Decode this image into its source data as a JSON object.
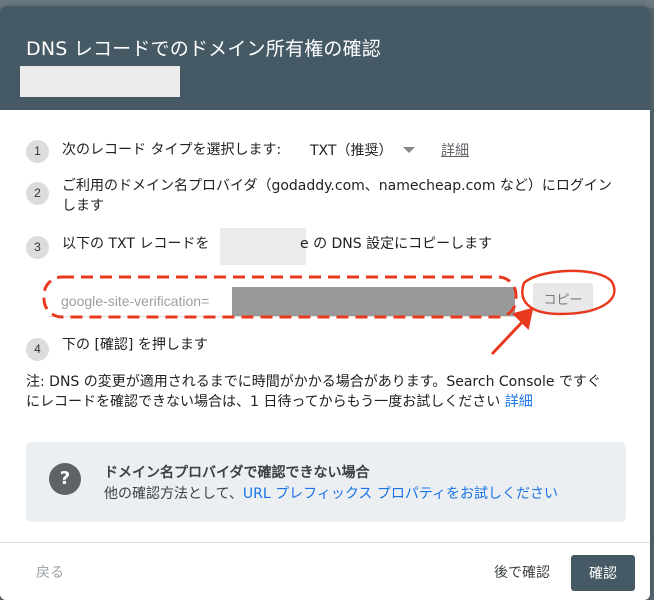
{
  "dialog": {
    "title": "DNS レコードでのドメイン所有権の確認"
  },
  "steps": {
    "s1": {
      "num": "1",
      "text": "次のレコード タイプを選択します:",
      "record_type": "TXT（推奨）",
      "detail_link": "詳細"
    },
    "s2": {
      "num": "2",
      "line1": "ご利用のドメイン名プロバイダ（godaddy.com、namecheap.com など）にログイン",
      "line2": "します"
    },
    "s3": {
      "num": "3",
      "before": "以下の TXT レコードを",
      "after": "e の DNS 設定にコピーします"
    },
    "s4": {
      "num": "4",
      "text": "下の [確認] を押します"
    }
  },
  "record": {
    "prefix": "google-site-verification=",
    "copy_label": "コピー"
  },
  "note": {
    "line1": "注: DNS の変更が適用されるまでに時間がかかる場合があります。Search Console ですぐ",
    "line2": "にレコードを確認できない場合は、1 日待ってからもう一度お試しください",
    "link": "詳細"
  },
  "help": {
    "icon": "help-icon",
    "title": "ドメイン名プロバイダで確認できない場合",
    "text": "他の確認方法として、",
    "link": "URL プレフィックス プロパティをお試しください"
  },
  "footer": {
    "back_label": "戻る",
    "later_label": "後で確認",
    "confirm_label": "確認"
  },
  "colors": {
    "header": "#455a64",
    "link": "#1a73e8",
    "annotation": "#e8391e"
  }
}
